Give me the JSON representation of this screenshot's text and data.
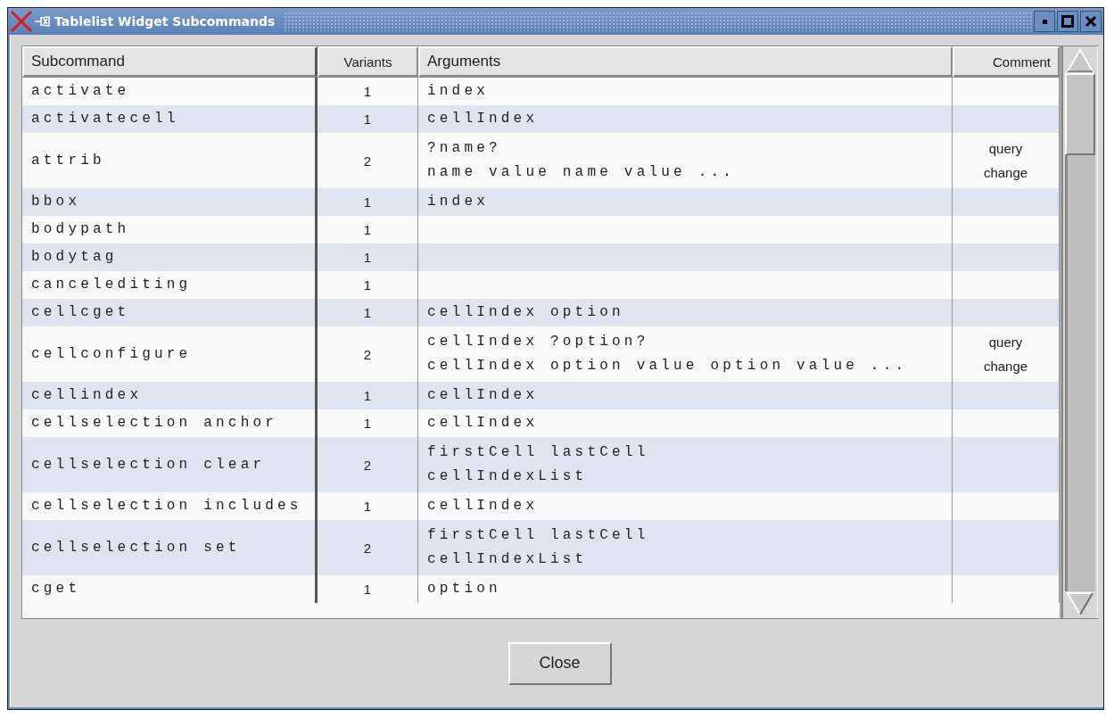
{
  "window": {
    "title": "Tablelist Widget Subcommands"
  },
  "table": {
    "columns": [
      {
        "label": "Subcommand"
      },
      {
        "label": "Variants"
      },
      {
        "label": "Arguments"
      },
      {
        "label": "Comment"
      }
    ],
    "rows": [
      {
        "subcommand": "activate",
        "variants": "1",
        "arguments": [
          "index"
        ],
        "comment": []
      },
      {
        "subcommand": "activatecell",
        "variants": "1",
        "arguments": [
          "cellIndex"
        ],
        "comment": []
      },
      {
        "subcommand": "attrib",
        "variants": "2",
        "arguments": [
          "?name?",
          "name value name value ..."
        ],
        "comment": [
          "query",
          "change"
        ]
      },
      {
        "subcommand": "bbox",
        "variants": "1",
        "arguments": [
          "index"
        ],
        "comment": []
      },
      {
        "subcommand": "bodypath",
        "variants": "1",
        "arguments": [],
        "comment": []
      },
      {
        "subcommand": "bodytag",
        "variants": "1",
        "arguments": [],
        "comment": []
      },
      {
        "subcommand": "cancelediting",
        "variants": "1",
        "arguments": [],
        "comment": []
      },
      {
        "subcommand": "cellcget",
        "variants": "1",
        "arguments": [
          "cellIndex option"
        ],
        "comment": []
      },
      {
        "subcommand": "cellconfigure",
        "variants": "2",
        "arguments": [
          "cellIndex ?option?",
          "cellIndex option value option value ..."
        ],
        "comment": [
          "query",
          "change"
        ]
      },
      {
        "subcommand": "cellindex",
        "variants": "1",
        "arguments": [
          "cellIndex"
        ],
        "comment": []
      },
      {
        "subcommand": "cellselection anchor",
        "variants": "1",
        "arguments": [
          "cellIndex"
        ],
        "comment": []
      },
      {
        "subcommand": "cellselection clear",
        "variants": "2",
        "arguments": [
          "firstCell lastCell",
          "cellIndexList"
        ],
        "comment": []
      },
      {
        "subcommand": "cellselection includes",
        "variants": "1",
        "arguments": [
          "cellIndex"
        ],
        "comment": []
      },
      {
        "subcommand": "cellselection set",
        "variants": "2",
        "arguments": [
          "firstCell lastCell",
          "cellIndexList"
        ],
        "comment": []
      },
      {
        "subcommand": "cget",
        "variants": "1",
        "arguments": [
          "option"
        ],
        "comment": []
      }
    ]
  },
  "buttons": [
    {
      "label": "Close"
    }
  ]
}
